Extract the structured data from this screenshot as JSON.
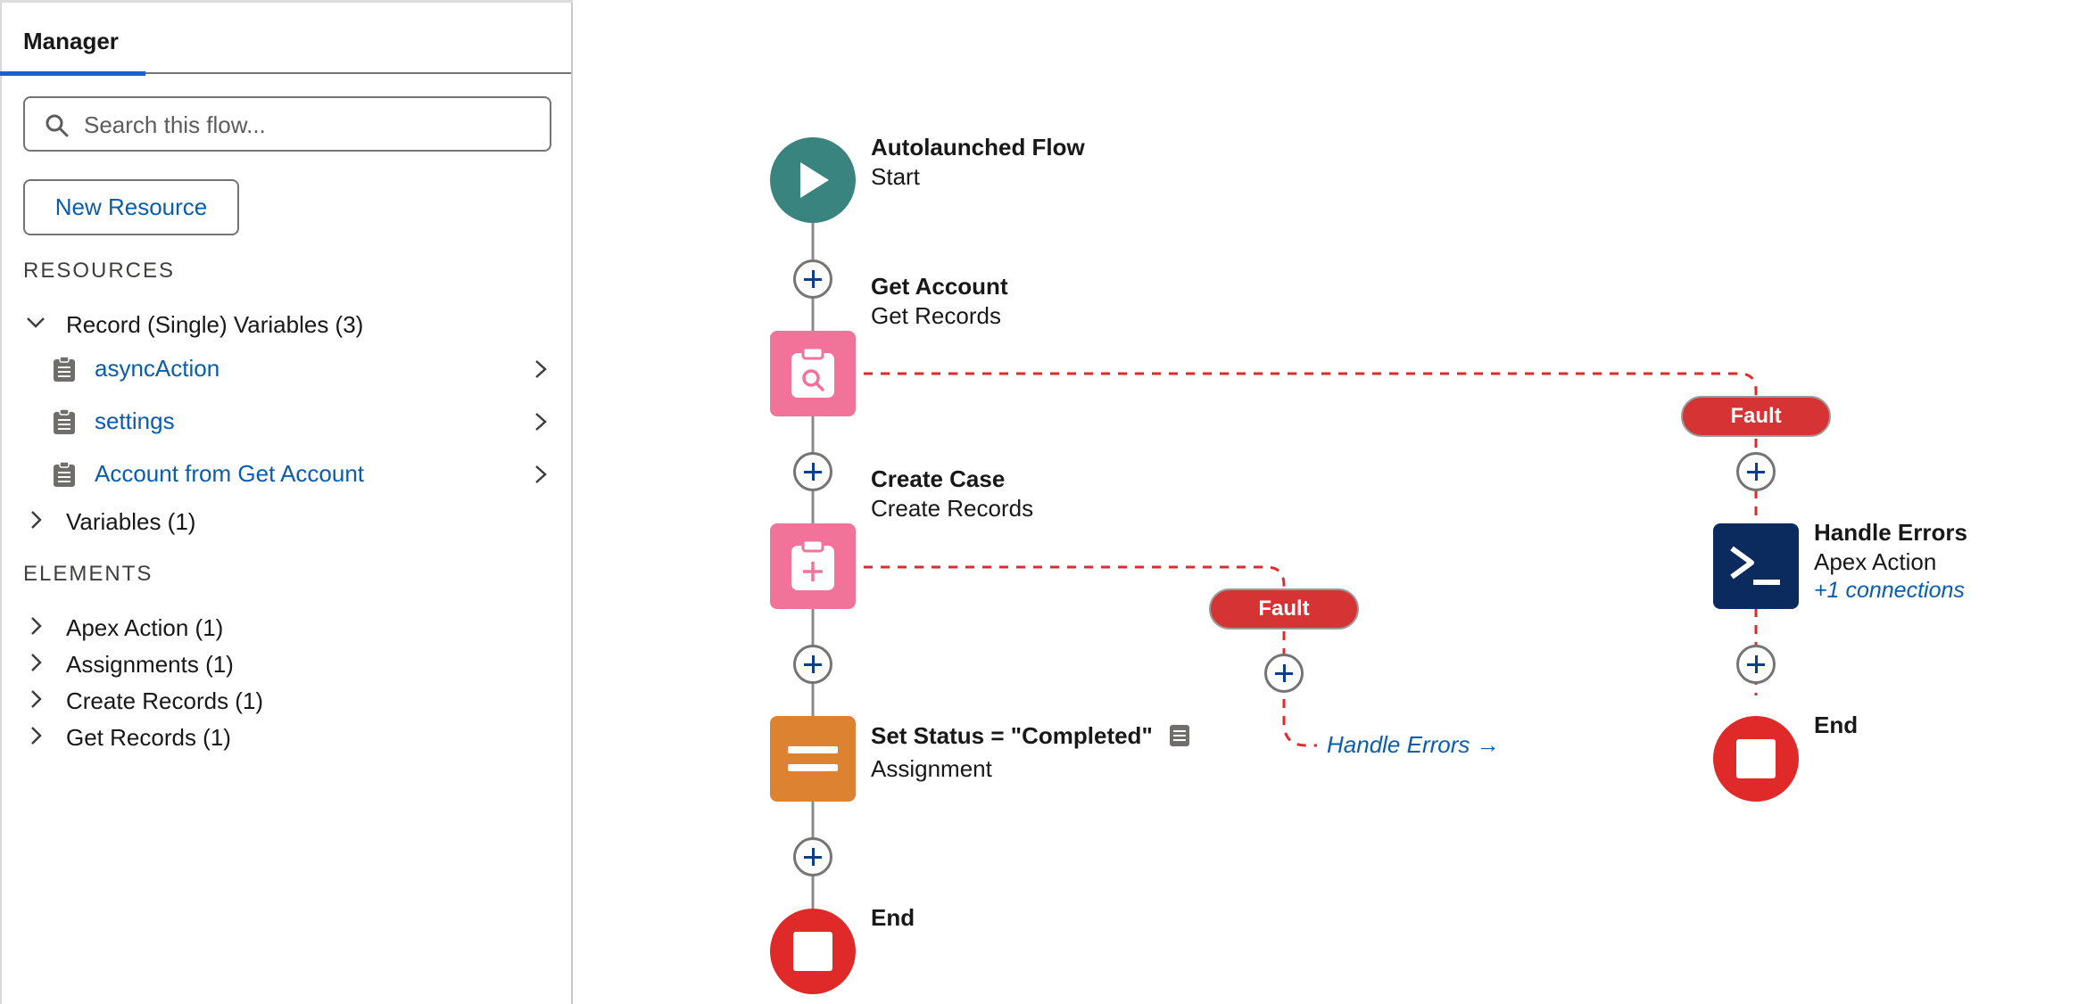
{
  "sidebar": {
    "tab_label": "Manager",
    "search": {
      "placeholder": "Search this flow..."
    },
    "new_resource_label": "New Resource",
    "resources_heading": "RESOURCES",
    "record_group_label": "Record (Single) Variables (3)",
    "records": [
      {
        "label": "asyncAction"
      },
      {
        "label": "settings"
      },
      {
        "label": "Account from Get Account"
      }
    ],
    "variables_label": "Variables (1)",
    "elements_heading": "ELEMENTS",
    "elements": [
      {
        "label": "Apex Action (1)"
      },
      {
        "label": "Assignments (1)"
      },
      {
        "label": "Create Records (1)"
      },
      {
        "label": "Get Records (1)"
      }
    ]
  },
  "flow": {
    "start": {
      "title": "Autolaunched Flow",
      "subtitle": "Start",
      "color": "#3a847f"
    },
    "get_account": {
      "title": "Get Account",
      "subtitle": "Get Records",
      "color": "#f2739a"
    },
    "create_case": {
      "title": "Create Case",
      "subtitle": "Create Records",
      "color": "#f2739a"
    },
    "set_status": {
      "title": "Set Status = \"Completed\"",
      "subtitle": "Assignment",
      "color": "#dd8230"
    },
    "end_main": {
      "title": "End",
      "color": "#e02a2a"
    },
    "handle_errors": {
      "title": "Handle Errors",
      "subtitle": "Apex Action",
      "connections": "+1 connections",
      "color": "#0b2a5e"
    },
    "end_fault": {
      "title": "End",
      "color": "#e02a2a"
    },
    "fault_label_1": "Fault",
    "fault_label_2": "Fault",
    "goto_label": "Handle Errors →",
    "fault_line_color": "#e02a2a"
  }
}
